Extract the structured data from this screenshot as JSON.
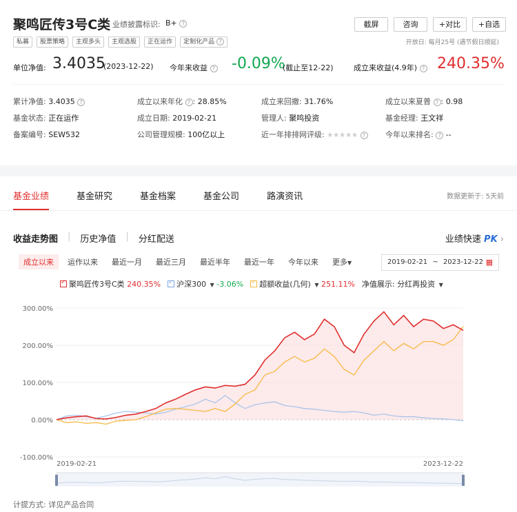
{
  "header": {
    "title": "聚鸣匠传3号C类",
    "disclosure_label": "业绩披露标识:",
    "disclosure_value": "B+",
    "tags": [
      "私募",
      "股票策略",
      "主观多头",
      "主观选股",
      "正在运作",
      "定制化产品"
    ],
    "buttons": [
      "截屏",
      "咨询",
      "+对比",
      "+自选"
    ],
    "open_day": "开放日: 每月25号 (遇节假日顺延)"
  },
  "metrics": {
    "nav_label": "单位净值:",
    "nav_value": "3.4035",
    "nav_date": "(2023-12-22)",
    "ytd_label": "今年来收益",
    "ytd_value": "-0.09%",
    "ytd_date": "(截止至12-22)",
    "since_label": "成立来收益(4.9年)",
    "since_value": "240.35%"
  },
  "info": {
    "cum_nav_label": "累计净值:",
    "cum_nav_value": "3.4035",
    "annual_label": "成立以来年化",
    "annual_value": "28.85%",
    "drawdown_label": "成立来回撤:",
    "drawdown_value": "31.76%",
    "sharpe_label": "成立以来夏普",
    "sharpe_value": "0.98",
    "status_label": "基金状态:",
    "status_value": "正在运作",
    "date_label": "成立日期:",
    "date_value": "2019-02-21",
    "manager_label": "管理人:",
    "manager_value": "聚鸣投资",
    "pm_label": "基金经理:",
    "pm_value": "王文祥",
    "record_label": "备案编号:",
    "record_value": "SEW532",
    "scale_label": "公司管理规模:",
    "scale_value": "100亿以上",
    "rating_label": "近一年排排网评级:",
    "rank_label": "今年以来排名:",
    "rank_value": "--"
  },
  "tabs": [
    "基金业绩",
    "基金研究",
    "基金档案",
    "基金公司",
    "路演资讯"
  ],
  "data_update": "数据更新于: 5天前",
  "subtabs": [
    "收益走势图",
    "历史净值",
    "分红配送"
  ],
  "quick_perf": "业绩快速",
  "pk": "PK",
  "ranges": [
    "成立以来",
    "运作以来",
    "最近一月",
    "最近三月",
    "最近半年",
    "最近一年",
    "今年以来",
    "更多"
  ],
  "date_from": "2019-02-21",
  "date_to": "2023-12-22",
  "legend": {
    "fund": "聚鸣匠传3号C类",
    "fund_val": "240.35%",
    "index": "沪深300",
    "index_val": "-3.06%",
    "excess": "超额收益(几何)",
    "excess_val": "251.11%",
    "nav_show_label": "净值展示:",
    "nav_show_value": "分红再投资"
  },
  "footnote": "计提方式: 详见产品合同",
  "colors": {
    "fund": "#e02d2d",
    "index": "#a8c4ec",
    "excess": "#f5b942"
  },
  "chart_data": {
    "type": "line",
    "x_start": "2019-02-21",
    "x_end": "2023-12-22",
    "ytick_labels": [
      "300.00%",
      "200.00%",
      "100.00%",
      "0.00%",
      "-100.00%"
    ],
    "ylim": [
      -100,
      300
    ],
    "series": [
      {
        "name": "聚鸣匠传3号C类",
        "values": [
          0,
          5,
          8,
          10,
          3,
          2,
          6,
          12,
          15,
          22,
          30,
          45,
          55,
          68,
          80,
          88,
          85,
          92,
          90,
          95,
          120,
          160,
          185,
          220,
          235,
          215,
          230,
          270,
          250,
          200,
          180,
          230,
          265,
          290,
          255,
          280,
          250,
          270,
          265,
          245,
          255,
          240
        ]
      },
      {
        "name": "沪深300",
        "values": [
          0,
          10,
          12,
          8,
          4,
          10,
          18,
          22,
          20,
          18,
          15,
          20,
          28,
          35,
          42,
          55,
          45,
          65,
          45,
          30,
          40,
          45,
          48,
          38,
          35,
          30,
          28,
          25,
          22,
          20,
          22,
          18,
          12,
          15,
          10,
          8,
          8,
          5,
          3,
          2,
          0,
          -3
        ]
      },
      {
        "name": "超额收益(几何)",
        "values": [
          0,
          -8,
          -6,
          -10,
          -8,
          -12,
          -4,
          -2,
          0,
          8,
          18,
          28,
          30,
          28,
          25,
          22,
          30,
          22,
          42,
          68,
          80,
          120,
          130,
          155,
          170,
          155,
          165,
          190,
          170,
          135,
          120,
          160,
          185,
          210,
          185,
          205,
          190,
          210,
          210,
          200,
          215,
          251
        ]
      }
    ]
  }
}
